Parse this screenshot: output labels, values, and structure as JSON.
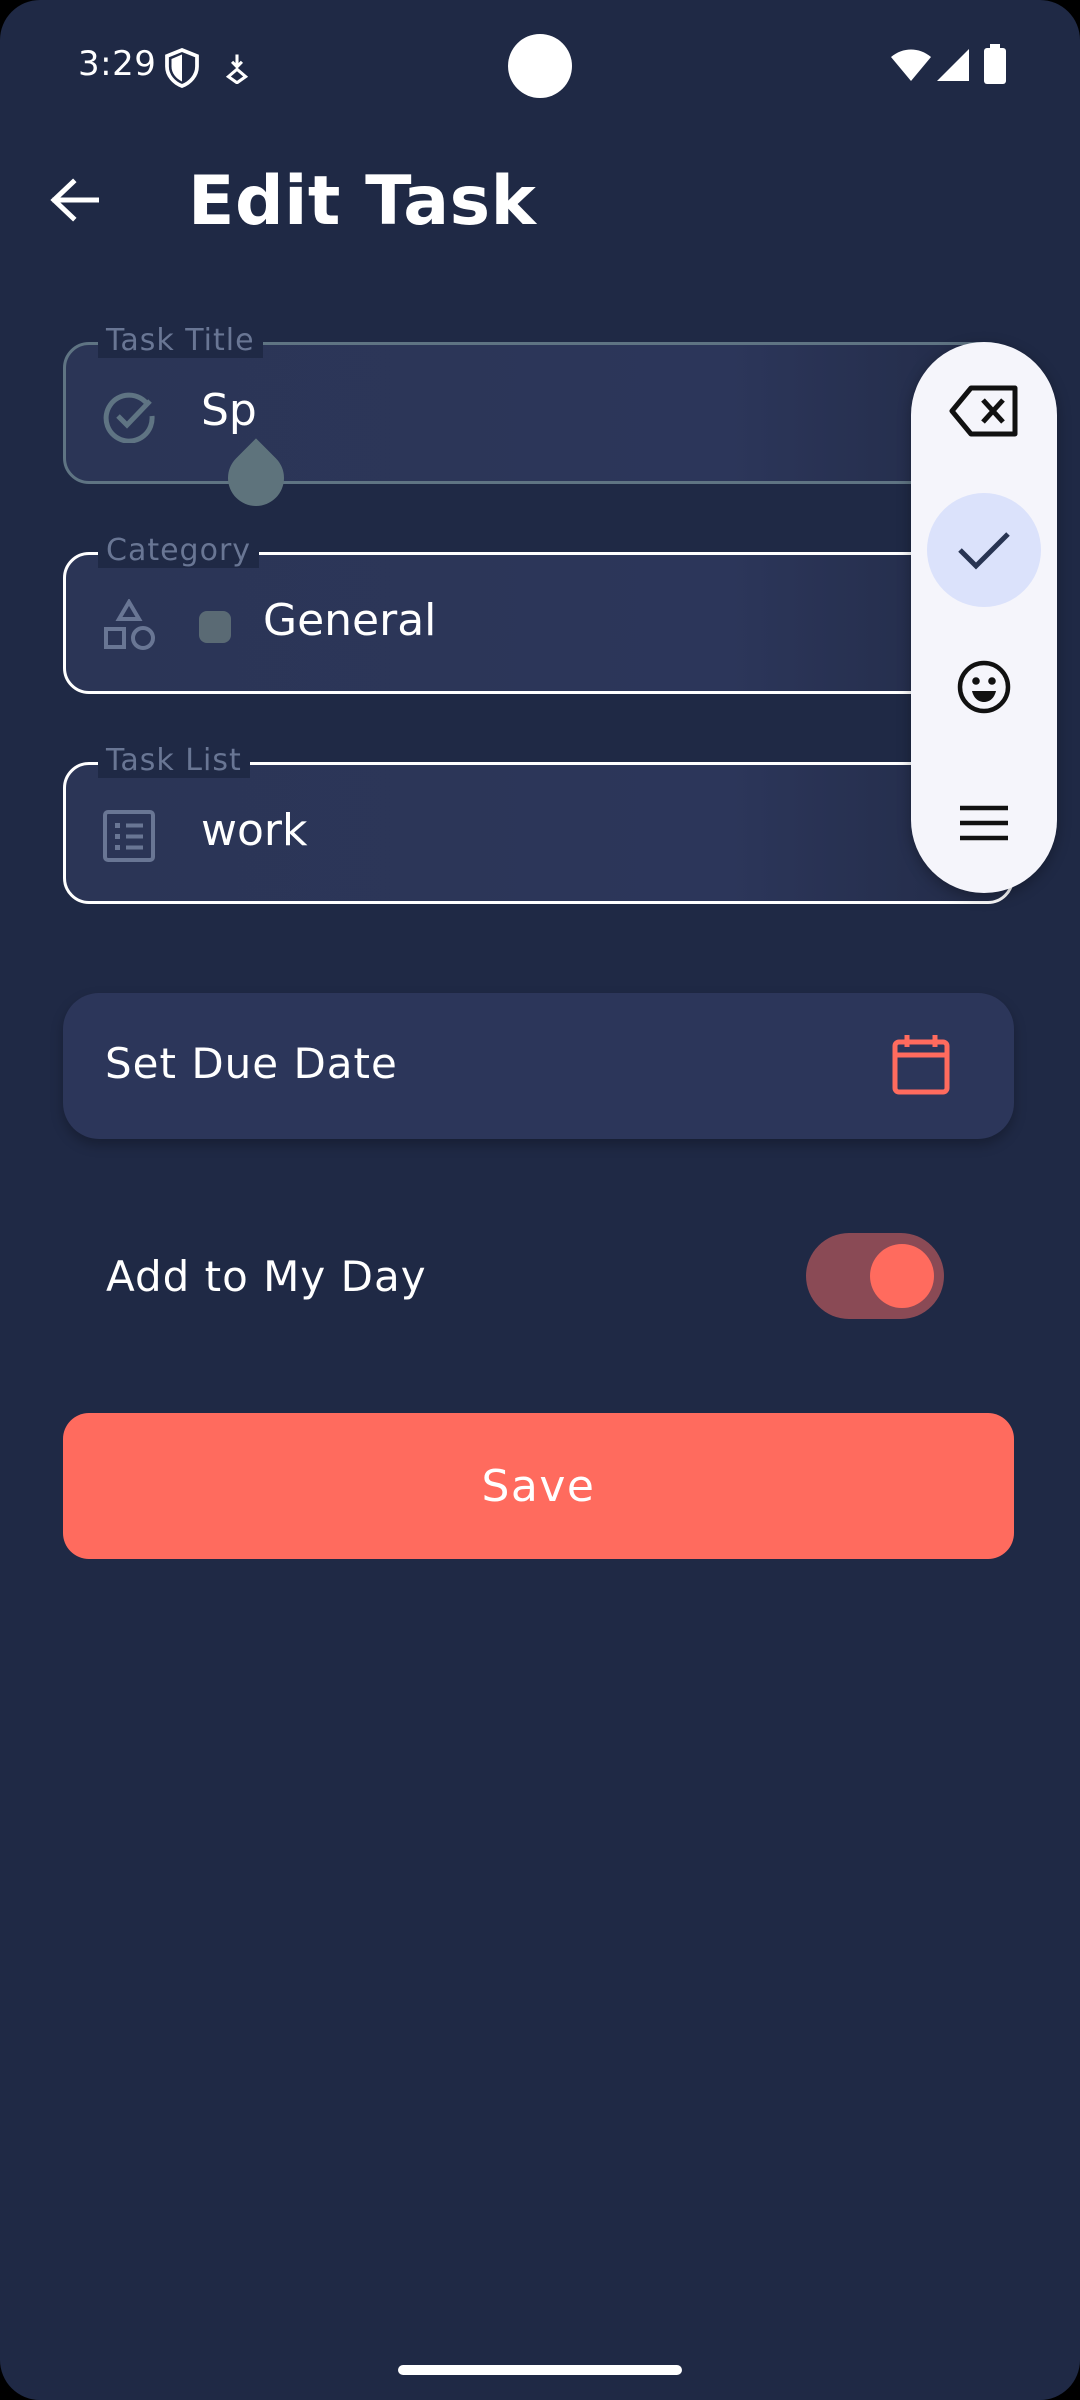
{
  "status_bar": {
    "time": "3:29",
    "icons": [
      "shield-icon",
      "download-icon",
      "wifi-icon",
      "signal-icon",
      "battery-icon"
    ]
  },
  "header": {
    "title": "Edit Task",
    "back_icon": "arrow-back-icon"
  },
  "form": {
    "task_title": {
      "label": "Task Title",
      "value": "Sp",
      "icon": "check-circle-icon"
    },
    "category": {
      "label": "Category",
      "value": "General",
      "icon": "shapes-icon",
      "swatch_color": "#5a6a74"
    },
    "task_list": {
      "label": "Task List",
      "value": "work",
      "icon": "list-icon"
    }
  },
  "due_date": {
    "label": "Set Due Date",
    "icon": "calendar-icon"
  },
  "my_day": {
    "label": "Add to My Day",
    "enabled": true
  },
  "save": {
    "label": "Save"
  },
  "keyboard_toolbar": {
    "items": [
      "backspace-icon",
      "check-icon",
      "emoji-icon",
      "menu-icon"
    ],
    "selected": "check-icon"
  },
  "colors": {
    "background": "#1f2945",
    "field": "#2c365a",
    "accent": "#ff6b5e",
    "label": "#697694"
  }
}
